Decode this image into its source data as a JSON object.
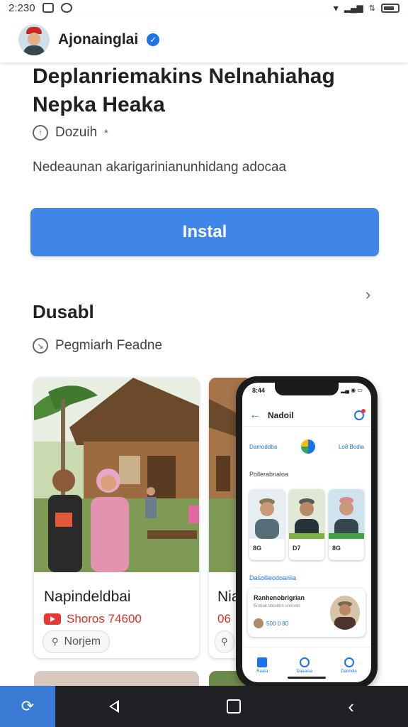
{
  "status_bar": {
    "time": "2:230"
  },
  "header": {
    "channel_name": "Ajonainglai"
  },
  "app": {
    "title": "Deplanriemakins Nelnahiahag Nepka Heaka",
    "rating_text": "Dozuih",
    "rating_suffix": "*",
    "description": "Nedeaunan akarigarinianunhidang adocaa",
    "install_label": "Instal"
  },
  "section": {
    "title": "Dusabl",
    "subtitle": "Pegmiarh Feadne"
  },
  "cards": [
    {
      "title": "Napindeldbai",
      "views": "Shoros 74600",
      "chip": "Norjem"
    },
    {
      "title": "Nia",
      "views": "06",
      "chip": ""
    }
  ],
  "phone": {
    "status_time": "8:44",
    "title": "Nadoil",
    "row_left": "Damoddba",
    "row_right": "Lo8 Bodia",
    "section1": "Pollerabnaloa",
    "people": [
      {
        "value": "8G",
        "accent": "#546e7a"
      },
      {
        "value": "D7",
        "accent": "#7cb342"
      },
      {
        "value": "8G",
        "accent": "#43a047"
      }
    ],
    "section2": "Dasollieodoaniia",
    "card_title": "Ranhenobrigrian",
    "card_sub": "Enarak oboobrn unnonln",
    "card_value": "500 0 80",
    "nav": [
      "Raata",
      "Daaaioa",
      "Danndia"
    ]
  }
}
